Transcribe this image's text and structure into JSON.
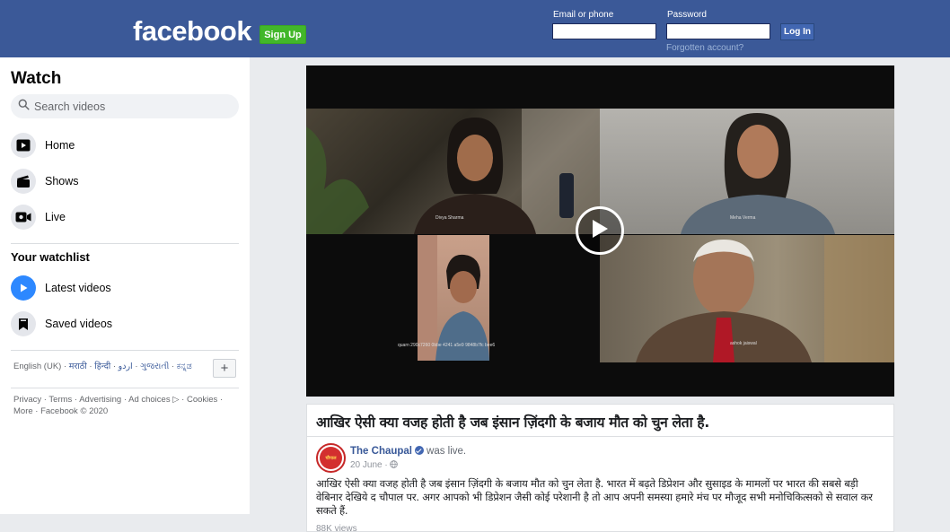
{
  "header": {
    "logo": "facebook",
    "signup_label": "Sign Up",
    "email_label": "Email or phone",
    "email_value": "",
    "password_label": "Password",
    "password_value": "",
    "login_label": "Log In",
    "forgot_label": "Forgotten account?",
    "colors": {
      "bar": "#3b5998",
      "signup": "#42b72a"
    }
  },
  "sidebar": {
    "title": "Watch",
    "search_placeholder": "Search videos",
    "nav": [
      {
        "label": "Home",
        "icon": "play-screen-icon"
      },
      {
        "label": "Shows",
        "icon": "clapperboard-icon"
      },
      {
        "label": "Live",
        "icon": "live-camera-icon"
      }
    ],
    "watchlist_title": "Your watchlist",
    "watchlist": [
      {
        "label": "Latest videos",
        "icon": "play-circle-icon"
      },
      {
        "label": "Saved videos",
        "icon": "bookmark-icon"
      }
    ],
    "languages": {
      "current": "English (UK)",
      "others": [
        "मराठी",
        "हिन्दी",
        "اردو",
        "ગુજરાતી",
        "ಕನ್ನಡ"
      ]
    },
    "add_language": "+",
    "footer": "Privacy · Terms · Advertising · Ad choices ▷ · Cookies · More · Facebook © 2020"
  },
  "video": {
    "participants": [
      "Divya Sharma",
      "Meha Verma",
      "quarn 290c7260 0bbe 4241 a5e9 9848b7fc bee6",
      "ashok jaiswal"
    ]
  },
  "post": {
    "title": "आखिर ऐसी क्या वजह होती है जब इंसान ज़िंदगी के बजाय मौत को चुन लेता है.",
    "page_name": "The Chaupal",
    "status": "was live.",
    "date": "20 June",
    "avatar_text": "चौपाल",
    "body": "आखिर ऐसी क्या वजह होती है जब इंसान ज़िंदगी के बजाय मौत को चुन लेता है. भारत में बढ़ते डिप्रेशन और सुसाइड के मामलों पर भारत की सबसे बड़ी वेबिनार देखिये द चौपाल पर. अगर आपको भी डिप्रेशन जैसी कोई परेशानी है तो आप अपनी समस्या हमारे मंच पर मौजूद सभी मनोचिकित्सको से सवाल कर सकते हैं.",
    "views": "88K views"
  }
}
